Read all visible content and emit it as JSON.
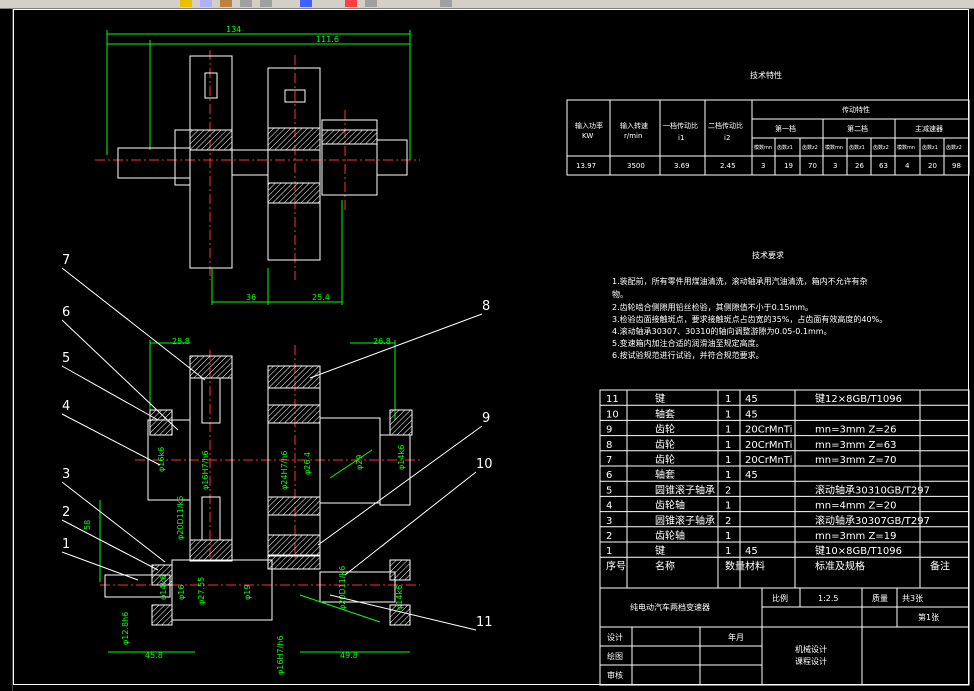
{
  "dimensions": {
    "top_total": "134",
    "top_right": "111.6",
    "top_bottom_left": "36",
    "top_bottom_right": "25.4",
    "bot_left_top": "25.8",
    "bot_right_top": "26.8",
    "d58": "58",
    "bot_left_bottom": "45.8",
    "bot_right_bottom": "49.8",
    "phi1": "φ12.8h6",
    "phi2": "φ14k6",
    "phi3": "φ16",
    "phi4": "φ27.55",
    "phi5": "φ19",
    "phi6": "φ16H7/h6",
    "phi7": "φ20D11/k6",
    "phi8": "φ16k6",
    "phi9": "φ16H7/h6",
    "phi10": "φ24H7/h6",
    "phi11": "φ26.4",
    "phi12": "φ29",
    "phi13": "φ14k6",
    "phi14": "φ20D11/k6",
    "phi15": "φ16H7/h6",
    "phi16": "φ14k6",
    "phi17": "φ16"
  },
  "callouts": [
    "1",
    "2",
    "3",
    "4",
    "5",
    "6",
    "7",
    "8",
    "9",
    "10",
    "11"
  ],
  "spec_table": {
    "title": "技术特性",
    "h_power": "输入功率",
    "h_power_unit": "KW",
    "h_speed": "输入转速",
    "h_speed_unit": "r/min",
    "h_ratio1": "一档传动比",
    "h_ratio1_sym": "i1",
    "h_ratio2": "二档传动比",
    "h_ratio2_sym": "i2",
    "h_trans": "传动特性",
    "h_g1": "第一档",
    "h_g2": "第二档",
    "h_g3": "主减速器",
    "h_sub": [
      "模数mn",
      "齿数z1",
      "齿数z2",
      "模数mn",
      "齿数z1",
      "齿数z2",
      "模数mn",
      "齿数z1",
      "齿数z2"
    ],
    "row": [
      "13.97",
      "3500",
      "3.69",
      "2.45",
      "3",
      "19",
      "70",
      "3",
      "26",
      "63",
      "4",
      "20",
      "98"
    ]
  },
  "tech_req": {
    "title": "技术要求",
    "lines": [
      "1.装配前，所有零件用煤油清洗，滚动轴承用汽油清洗，箱内不允许有杂",
      "物。",
      "2.齿轮啮合侧隙用铅丝检验，其侧隙值不小于0.15mm。",
      "3.检验齿面接触斑点，要求接触斑点占齿宽的35%，占齿面有效高度的40%。",
      "4.滚动轴承30307、30310的轴向调整游隙为0.05-0.1mm。",
      "5.变速箱内加注合适的润滑油至规定高度。",
      "6.按试验规范进行试验，并符合规范要求。"
    ]
  },
  "parts": [
    {
      "no": "11",
      "name": "键",
      "qty": "1",
      "mat": "45",
      "std": "键12×8GB/T1096",
      "note": ""
    },
    {
      "no": "10",
      "name": "轴套",
      "qty": "1",
      "mat": "45",
      "std": "",
      "note": ""
    },
    {
      "no": "9",
      "name": "齿轮",
      "qty": "1",
      "mat": "20CrMnTi",
      "std": "mn=3mm  Z=26",
      "note": ""
    },
    {
      "no": "8",
      "name": "齿轮",
      "qty": "1",
      "mat": "20CrMnTi",
      "std": "mn=3mm  Z=63",
      "note": ""
    },
    {
      "no": "7",
      "name": "齿轮",
      "qty": "1",
      "mat": "20CrMnTi",
      "std": "mn=3mm  Z=70",
      "note": ""
    },
    {
      "no": "6",
      "name": "轴套",
      "qty": "1",
      "mat": "45",
      "std": "",
      "note": ""
    },
    {
      "no": "5",
      "name": "圆锥滚子轴承",
      "qty": "2",
      "mat": "",
      "std": "滚动轴承30310GB/T297",
      "note": ""
    },
    {
      "no": "4",
      "name": "齿轮轴",
      "qty": "1",
      "mat": "",
      "std": "mn=4mm  Z=20",
      "note": ""
    },
    {
      "no": "3",
      "name": "圆锥滚子轴承",
      "qty": "2",
      "mat": "",
      "std": "滚动轴承30307GB/T297",
      "note": ""
    },
    {
      "no": "2",
      "name": "齿轮轴",
      "qty": "1",
      "mat": "",
      "std": "mn=3mm  Z=19",
      "note": ""
    },
    {
      "no": "1",
      "name": "键",
      "qty": "1",
      "mat": "45",
      "std": "键10×8GB/T1096",
      "note": ""
    }
  ],
  "parts_header": {
    "no": "序号",
    "name": "名称",
    "qty": "数量",
    "mat": "材料",
    "std": "标准及规格",
    "note": "备注"
  },
  "title_block": {
    "drawing_title": "纯电动汽车两档变速器",
    "scale_label": "比例",
    "scale": "1:2.5",
    "mass_label": "质量",
    "sheets_total": "共3张",
    "sheet_no": "第1张",
    "design": "设计",
    "drawing": "绘图",
    "review": "审核",
    "date": "年月",
    "course1": "机械设计",
    "course2": "课程设计"
  }
}
